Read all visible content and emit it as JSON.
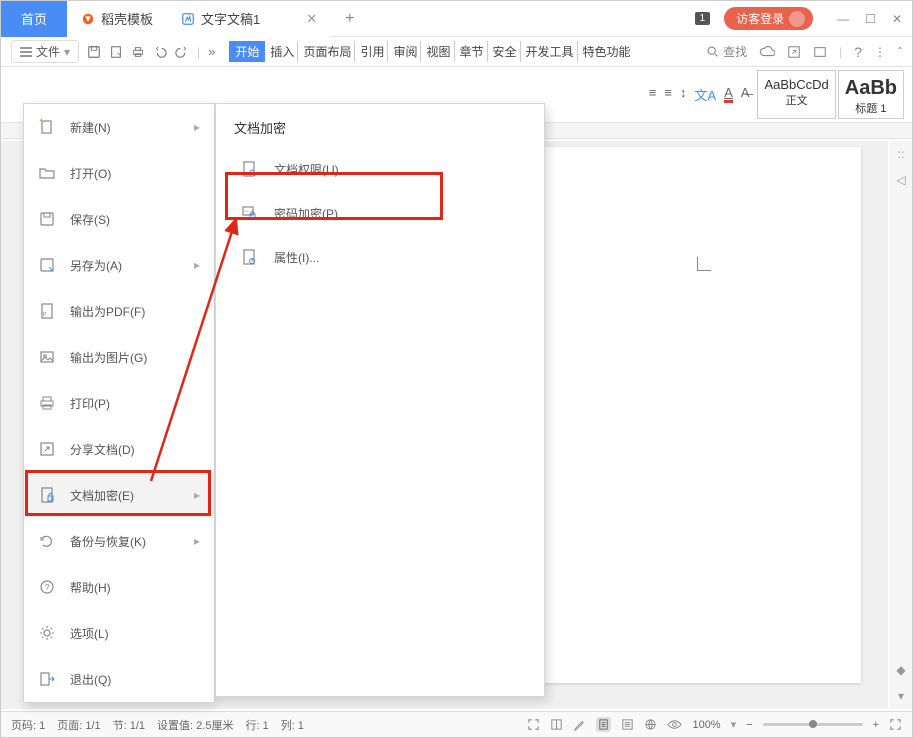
{
  "titlebar": {
    "home": "首页",
    "template": "稻壳模板",
    "doc": "文字文稿1",
    "badge": "1",
    "login": "访客登录"
  },
  "toolbar": {
    "file": "文件",
    "ribbon": [
      "开始",
      "插入",
      "页面布局",
      "引用",
      "审阅",
      "视图",
      "章节",
      "安全",
      "开发工具",
      "特色功能"
    ],
    "search": "查找"
  },
  "styles": {
    "normal_preview": "AaBbCcDd",
    "normal_label": "正文",
    "h1_preview": "AaBb",
    "h1_label": "标题 1"
  },
  "file_menu": {
    "items": [
      {
        "label": "新建(N)",
        "arrow": true
      },
      {
        "label": "打开(O)"
      },
      {
        "label": "保存(S)"
      },
      {
        "label": "另存为(A)",
        "arrow": true
      },
      {
        "label": "输出为PDF(F)"
      },
      {
        "label": "输出为图片(G)"
      },
      {
        "label": "打印(P)"
      },
      {
        "label": "分享文档(D)"
      },
      {
        "label": "文档加密(E)",
        "arrow": true
      },
      {
        "label": "备份与恢复(K)",
        "arrow": true
      },
      {
        "label": "帮助(H)"
      },
      {
        "label": "选项(L)"
      },
      {
        "label": "退出(Q)"
      }
    ]
  },
  "sub_menu": {
    "title": "文档加密",
    "items": [
      {
        "label": "文档权限(U)"
      },
      {
        "label": "密码加密(P)"
      },
      {
        "label": "属性(I)..."
      }
    ]
  },
  "status": {
    "page_no": "页码: 1",
    "page": "页面: 1/1",
    "sec": "节: 1/1",
    "setting": "设置值: 2.5厘米",
    "row": "行: 1",
    "col": "列: 1",
    "zoom": "100%"
  }
}
